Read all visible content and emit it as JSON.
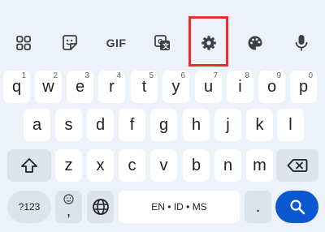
{
  "toolbar": {
    "items": [
      {
        "name": "apps-grid-icon"
      },
      {
        "name": "sticker-icon"
      },
      {
        "name": "gif-button",
        "label": "GIF"
      },
      {
        "name": "translate-icon"
      },
      {
        "name": "settings-icon"
      },
      {
        "name": "theme-palette-icon"
      },
      {
        "name": "microphone-icon"
      }
    ],
    "highlighted": "settings-icon",
    "highlight_color": "#e2312b"
  },
  "keyboard": {
    "row1": [
      {
        "label": "q",
        "hint": "1"
      },
      {
        "label": "w",
        "hint": "2"
      },
      {
        "label": "e",
        "hint": "3"
      },
      {
        "label": "r",
        "hint": "4"
      },
      {
        "label": "t",
        "hint": "5"
      },
      {
        "label": "y",
        "hint": "6"
      },
      {
        "label": "u",
        "hint": "7"
      },
      {
        "label": "i",
        "hint": "8"
      },
      {
        "label": "o",
        "hint": "9"
      },
      {
        "label": "p",
        "hint": "0"
      }
    ],
    "row2": [
      "a",
      "s",
      "d",
      "f",
      "g",
      "h",
      "j",
      "k",
      "l"
    ],
    "row3": [
      "z",
      "x",
      "c",
      "v",
      "b",
      "n",
      "m"
    ],
    "symbols_key": "?123",
    "emoji_comma_key": ",",
    "space_label": "EN • ID • MS",
    "period_key": ".",
    "colors": {
      "background": "#edf2fa",
      "key": "#ffffff",
      "function_key": "#dde3ea",
      "action_key": "#0b57d0"
    }
  }
}
